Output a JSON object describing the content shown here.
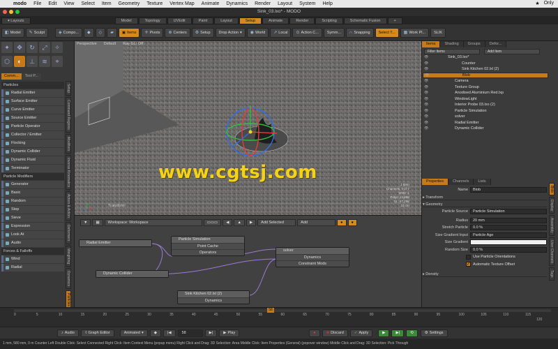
{
  "menubar": {
    "app": "modo",
    "menus": [
      "File",
      "Edit",
      "View",
      "Select",
      "Item",
      "Geometry",
      "Texture",
      "Vertex Map",
      "Animate",
      "Dynamics",
      "Render",
      "Layout",
      "System",
      "Help"
    ],
    "right": "Only"
  },
  "window": {
    "title": "Sink_03.lxo* - MODO"
  },
  "layout_tabs": {
    "label": "Layouts",
    "tabs": [
      "Model",
      "Topology",
      "UVEdit",
      "Paint",
      "Layout",
      "Setup",
      "Animate",
      "Render",
      "Scripting",
      "Schematic Fusion"
    ],
    "active": "Setup",
    "add": "+"
  },
  "toolbar": {
    "buttons": [
      "Model",
      "Sculpt",
      "Compo...",
      "Items",
      "Pivots",
      "Centers",
      "Setup",
      "Drop Action",
      "World",
      "Local",
      "Action C...",
      "Symm...",
      "Snapping",
      "Select T...",
      "Work Pl...",
      "SLIK"
    ],
    "active": [
      "Items",
      "Select T..."
    ]
  },
  "toolbox": {
    "tabs": [
      "Comm...",
      "Tool P..."
    ],
    "sections": [
      {
        "title": "Particles",
        "items": [
          "Radial Emitter",
          "Surface Emitter",
          "Curve Emitter",
          "Source Emitter",
          "Particle Operator",
          "Collector / Emitter",
          "Flocking",
          "Dynamic Collider",
          "Dynamic Fluid",
          "Terminator"
        ]
      },
      {
        "title": "Particle Modifiers",
        "items": [
          "Generator",
          "Basic",
          "Random",
          "Step",
          "Sieve",
          "Expression",
          "Look At",
          "Audio"
        ]
      },
      {
        "title": "Forces & Falloffs",
        "items": [
          "Wind",
          "Radial"
        ]
      }
    ],
    "vertical_tabs": [
      "Setup",
      "Command Regions",
      "Modifiers",
      "Inverse Kinematics",
      "Actors & Action",
      "Deformers",
      "Weighting",
      "Dynamics",
      "Particles"
    ],
    "active_vertical_tab": "Particles"
  },
  "viewport": {
    "view": "Perspective",
    "shading": "Default",
    "ray": "Ray GL: Off",
    "tool_label": "Transform",
    "info": [
      "1 Item",
      "Channels: 0 of 7",
      "Verts: 1",
      "Polys: 24,898",
      "GL: 57,298",
      "10 cm"
    ]
  },
  "watermark": "www.cgtsj.com",
  "schematic": {
    "workspace": "Workspace: Workspace",
    "add_selected": "Add Selected",
    "add": "Add",
    "nodes": [
      {
        "title": "Particle Simulation",
        "rows": [
          "Point Cache",
          "Operators"
        ]
      },
      {
        "title": "Radial Emitter",
        "rows": []
      },
      {
        "title": "solver",
        "rows": [
          "Dynamics",
          "Constraint Mods"
        ]
      },
      {
        "title": "Dynamic Collider",
        "rows": []
      },
      {
        "title": "Sink Kitchen 02.lxl (2)",
        "rows": [
          "Dynamics"
        ]
      }
    ]
  },
  "item_panel": {
    "tabs": [
      "Items",
      "Shading",
      "Groups",
      "Defor..."
    ],
    "filter": "Filter Items",
    "add_item": "Add Item",
    "items": [
      {
        "name": "Sink_03.lxo*",
        "indent": 0
      },
      {
        "name": "Counter",
        "indent": 2
      },
      {
        "name": "Sink Kitchen 02.lxl (2)",
        "indent": 2
      },
      {
        "name": "Blob",
        "indent": 2,
        "selected": true
      },
      {
        "name": "Camera",
        "indent": 1
      },
      {
        "name": "Texture Group",
        "indent": 1
      },
      {
        "name": "Anodised Aluminium Red.lxp",
        "indent": 1
      },
      {
        "name": "WindowLight",
        "indent": 1
      },
      {
        "name": "Interior Probe 03.lxo (2)",
        "indent": 1
      },
      {
        "name": "Particle Simulation",
        "indent": 1
      },
      {
        "name": "solver",
        "indent": 1
      },
      {
        "name": "Radial Emitter",
        "indent": 1
      },
      {
        "name": "Dynamic Collider",
        "indent": 1
      }
    ]
  },
  "properties": {
    "tabs": [
      "Properties",
      "Channels",
      "Lists"
    ],
    "name_label": "Name",
    "name_value": "Blob",
    "groups": [
      "Transform",
      "Geometry",
      "Density"
    ],
    "fields": [
      {
        "label": "Particle Source",
        "value": "Particle Simulation"
      },
      {
        "label": "Radius",
        "value": "20 mm"
      },
      {
        "label": "Stretch Particle",
        "value": "0.0 %"
      },
      {
        "label": "Size Gradient Input",
        "value": "Particle Age"
      },
      {
        "label": "Size Gradient",
        "value": ""
      },
      {
        "label": "Random Size",
        "value": "0.0 %"
      }
    ],
    "checkboxes": [
      {
        "label": "Use Particle Orientations",
        "checked": false
      },
      {
        "label": "Automatic Texture Offset",
        "checked": true
      }
    ],
    "vertical_tabs": [
      "Blob",
      "Display",
      "Assembly",
      "User Channels",
      "Tags"
    ]
  },
  "timeline": {
    "ticks": [
      "0",
      "5",
      "10",
      "15",
      "20",
      "25",
      "30",
      "35",
      "40",
      "45",
      "50",
      "55",
      "60",
      "65",
      "70",
      "75",
      "80",
      "85",
      "90",
      "95",
      "100",
      "105",
      "110",
      "115",
      "120"
    ],
    "current_marker": "58",
    "end_value": "120"
  },
  "transport": {
    "audio": "Audio",
    "graph_editor": "Graph Editor",
    "animated": "Animated",
    "frame": "58",
    "play": "Play",
    "discard": "Discard",
    "apply": "Apply",
    "settings": "Settings"
  },
  "status": "1 mm, 580 mm, 0 m  Counter  Left Double Click: Select Connected  Right Click: Item Context Menu (popup menu)  Right Click and Drag: 3D Selection: Area  Middle Click: Item Properties (General) (popover window)  Middle Click and Drag: 3D Selection: Pick Through"
}
